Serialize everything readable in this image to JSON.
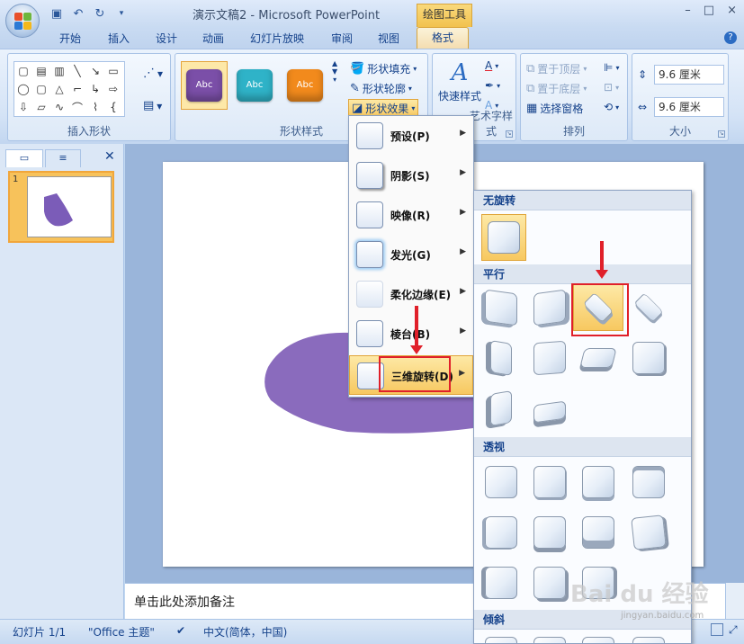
{
  "window": {
    "title": "演示文稿2 - Microsoft PowerPoint",
    "context_tab_group": "绘图工具",
    "controls": [
      "–",
      "□",
      "×"
    ]
  },
  "tabs": [
    "开始",
    "插入",
    "设计",
    "动画",
    "幻灯片放映",
    "审阅",
    "视图"
  ],
  "active_tab": "格式",
  "ribbon": {
    "insert_shapes": {
      "label": "插入形状"
    },
    "shape_styles": {
      "label": "形状样式",
      "thumbs": [
        {
          "text": "Abc",
          "color": "#7b4fa8"
        },
        {
          "text": "Abc",
          "color": "#2fb3c8"
        },
        {
          "text": "Abc",
          "color": "#f28a1c"
        }
      ],
      "fill": "形状填充",
      "outline": "形状轮廓",
      "effects": "形状效果"
    },
    "wordart": {
      "quick_styles": "快速样式",
      "label": "艺术字样式"
    },
    "arrange": {
      "label": "排列",
      "bring_front": "置于顶层",
      "send_back": "置于底层",
      "selection_pane": "选择窗格"
    },
    "size": {
      "label": "大小",
      "height": "9.6 厘米",
      "width": "9.6 厘米"
    }
  },
  "effects_menu": [
    {
      "label": "预设(P)"
    },
    {
      "label": "阴影(S)"
    },
    {
      "label": "映像(R)"
    },
    {
      "label": "发光(G)"
    },
    {
      "label": "柔化边缘(E)"
    },
    {
      "label": "棱台(B)"
    },
    {
      "label": "三维旋转(D)"
    }
  ],
  "gallery": {
    "no_rotation": "无旋转",
    "parallel": "平行",
    "perspective": "透视",
    "oblique": "倾斜"
  },
  "slides_pane": {
    "slide_number": "1"
  },
  "notes_placeholder": "单击此处添加备注",
  "status": {
    "slide": "幻灯片 1/1",
    "theme": "\"Office 主题\"",
    "language": "中文(简体，中国)"
  },
  "watermark": {
    "main": "Bai du 经验",
    "sub": "jingyan.baidu.com"
  },
  "colors": {
    "shape": "#8a6bbd",
    "highlight": "#e0202a",
    "selected": "#f7c860"
  }
}
